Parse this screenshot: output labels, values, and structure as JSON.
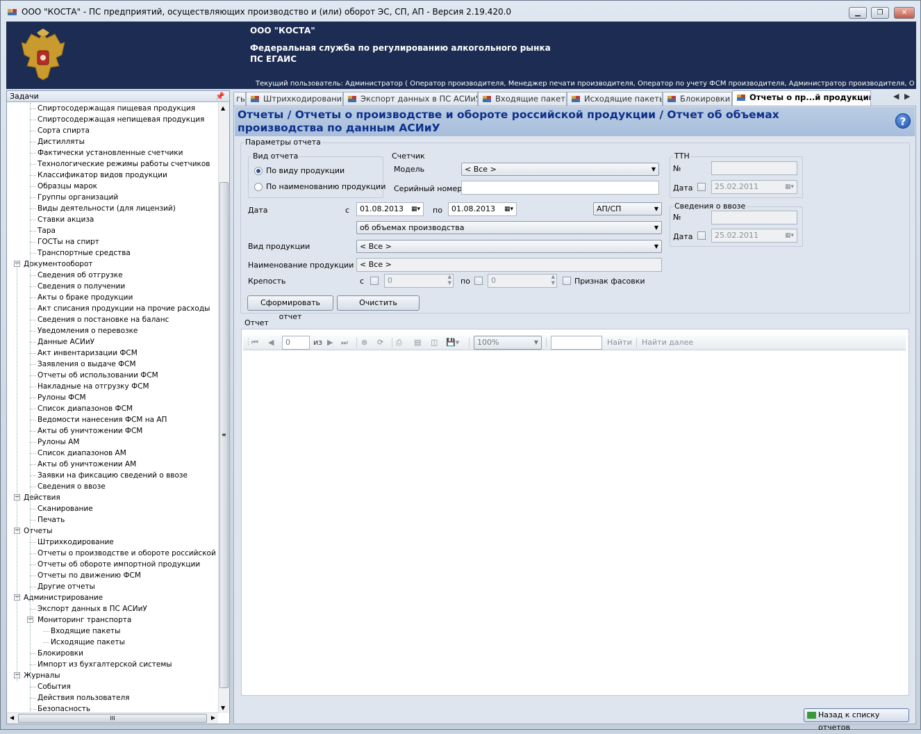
{
  "window": {
    "title": "ООО \"КОСТА\" - ПС предприятий, осуществляющих производство и (или) оборот ЭС, СП, АП - Версия 2.19.420.0",
    "controls": [
      "minimize-icon",
      "maximize-icon",
      "close-icon"
    ]
  },
  "banner": {
    "org": "ООО \"КОСТА\"",
    "service_line1": "Федеральная служба по регулированию алкогольного рынка",
    "service_line2": "ПС ЕГАИС",
    "current_user": "Текущий пользователь: Администратор ( Оператор производителя, Менеджер печати производителя, Оператор по учету ФСМ производителя, Администратор производителя, Операт..."
  },
  "tasks_panel": {
    "title": "Задачи",
    "pin_icon": "pin-icon",
    "items": [
      {
        "level": 1,
        "label": "Спиртосодержащая пищевая продукция"
      },
      {
        "level": 1,
        "label": "Спиртосодержащая непищевая продукция"
      },
      {
        "level": 1,
        "label": "Сорта спирта"
      },
      {
        "level": 1,
        "label": "Дистилляты"
      },
      {
        "level": 1,
        "label": "Фактически установленные счетчики"
      },
      {
        "level": 1,
        "label": "Технологические режимы работы счетчиков"
      },
      {
        "level": 1,
        "label": "Классификатор видов продукции"
      },
      {
        "level": 1,
        "label": "Образцы марок"
      },
      {
        "level": 1,
        "label": "Группы организаций"
      },
      {
        "level": 1,
        "label": "Виды деятельности (для лицензий)"
      },
      {
        "level": 1,
        "label": "Ставки акциза"
      },
      {
        "level": 1,
        "label": "Тара"
      },
      {
        "level": 1,
        "label": "ГОСТы на спирт"
      },
      {
        "level": 1,
        "label": "Транспортные средства"
      },
      {
        "level": 0,
        "label": "Документооборот",
        "expanded": true
      },
      {
        "level": 1,
        "label": "Сведения об отгрузке"
      },
      {
        "level": 1,
        "label": "Сведения о получении"
      },
      {
        "level": 1,
        "label": "Акты о браке продукции"
      },
      {
        "level": 1,
        "label": "Акт списания продукции на прочие расходы"
      },
      {
        "level": 1,
        "label": "Сведения о постановке на баланс"
      },
      {
        "level": 1,
        "label": "Уведомления о перевозке"
      },
      {
        "level": 1,
        "label": "Данные АСИиУ"
      },
      {
        "level": 1,
        "label": "Акт инвентаризации ФСМ"
      },
      {
        "level": 1,
        "label": "Заявления о выдаче ФСМ"
      },
      {
        "level": 1,
        "label": "Отчеты об использовании ФСМ"
      },
      {
        "level": 1,
        "label": "Накладные на отгрузку ФСМ"
      },
      {
        "level": 1,
        "label": "Рулоны ФСМ"
      },
      {
        "level": 1,
        "label": "Список диапазонов ФСМ"
      },
      {
        "level": 1,
        "label": "Ведомости нанесения ФСМ на АП"
      },
      {
        "level": 1,
        "label": "Акты об уничтожении ФСМ"
      },
      {
        "level": 1,
        "label": "Рулоны АМ"
      },
      {
        "level": 1,
        "label": "Список диапазонов АМ"
      },
      {
        "level": 1,
        "label": "Акты об уничтожении АМ"
      },
      {
        "level": 1,
        "label": "Заявки на фиксацию сведений о ввозе"
      },
      {
        "level": 1,
        "label": "Сведения о ввозе"
      },
      {
        "level": 0,
        "label": "Действия",
        "expanded": true
      },
      {
        "level": 1,
        "label": "Сканирование"
      },
      {
        "level": 1,
        "label": "Печать"
      },
      {
        "level": 0,
        "label": "Отчеты",
        "expanded": true
      },
      {
        "level": 1,
        "label": "Штрихкодирование"
      },
      {
        "level": 1,
        "label": "Отчеты о производстве и обороте российской про,"
      },
      {
        "level": 1,
        "label": "Отчеты об обороте импортной продукции"
      },
      {
        "level": 1,
        "label": "Отчеты по движению ФСМ"
      },
      {
        "level": 1,
        "label": "Другие отчеты"
      },
      {
        "level": 0,
        "label": "Администрирование",
        "expanded": true
      },
      {
        "level": 1,
        "label": "Экспорт данных в ПС АСИиУ"
      },
      {
        "level": 1,
        "label": "Мониторинг транспорта",
        "expanded": true
      },
      {
        "level": 2,
        "label": "Входящие пакеты"
      },
      {
        "level": 2,
        "label": "Исходящие пакеты"
      },
      {
        "level": 1,
        "label": "Блокировки"
      },
      {
        "level": 1,
        "label": "Импорт из бухгалтерской системы"
      },
      {
        "level": 0,
        "label": "Журналы",
        "expanded": true
      },
      {
        "level": 1,
        "label": "События"
      },
      {
        "level": 1,
        "label": "Действия пользователя"
      },
      {
        "level": 1,
        "label": "Безопасность"
      }
    ]
  },
  "tabs": [
    {
      "label": "гь",
      "icon": null,
      "active": false
    },
    {
      "label": "Штрихкодирование",
      "icon": "document-icon",
      "active": false
    },
    {
      "label": "Экспорт данных в ПС АСИиУ",
      "icon": "document-icon",
      "active": false
    },
    {
      "label": "Входящие пакеты",
      "icon": "document-icon",
      "active": false
    },
    {
      "label": "Исходящие пакеты",
      "icon": "document-icon",
      "active": false
    },
    {
      "label": "Блокировки",
      "icon": "document-icon",
      "active": false
    },
    {
      "label": "Отчеты о пр...й продукции",
      "icon": "document-icon",
      "active": true
    }
  ],
  "tab_nav": {
    "prev": "◀",
    "next": "▶"
  },
  "page": {
    "title": "Отчеты / Отчеты о производстве и обороте российской продукции / Отчет об объемах производства по данным АСИиУ",
    "help_label": "?"
  },
  "params": {
    "group_title": "Параметры отчета",
    "report_kind": {
      "title": "Вид отчета",
      "option_by_type": "По виду продукции",
      "option_by_name": "По наименованию продукции",
      "selected": "По виду продукции"
    },
    "counter": {
      "title": "Счетчик",
      "model_label": "Модель",
      "model_value": "< Все >",
      "serial_label": "Серийный номер",
      "serial_value": ""
    },
    "ttn": {
      "title": "ТТН",
      "number_label": "№",
      "number_value": "",
      "date_label": "Дата",
      "date_value": "25.02.2011",
      "date_checked": false
    },
    "import_info": {
      "title": "Сведения о ввозе",
      "number_label": "№",
      "number_value": "",
      "date_label": "Дата",
      "date_value": "25.02.2011",
      "date_checked": false
    },
    "date": {
      "label": "Дата",
      "from_label": "с",
      "from_value": "01.08.2013",
      "to_label": "по",
      "to_value": "01.08.2013"
    },
    "product_class": "АП/СП",
    "report_subject": "об объемах производства",
    "product_kind": {
      "label": "Вид продукции",
      "value": "< Все >"
    },
    "product_name": {
      "label": "Наименование продукции",
      "value": "< Все >"
    },
    "strength": {
      "label": "Крепость",
      "from_label": "с",
      "from_value": "0",
      "to_label": "по",
      "to_value": "0",
      "packing_label": "Признак фасовки"
    },
    "generate_button": "Сформировать отчет",
    "clear_button": "Очистить"
  },
  "report": {
    "group_title": "Отчет",
    "toolbar": {
      "page_value": "0",
      "of_label": "из",
      "zoom": "100%",
      "find_value": "",
      "find_label": "Найти",
      "find_next_label": "Найти далее"
    }
  },
  "back_button": "Назад к списку отчетов"
}
